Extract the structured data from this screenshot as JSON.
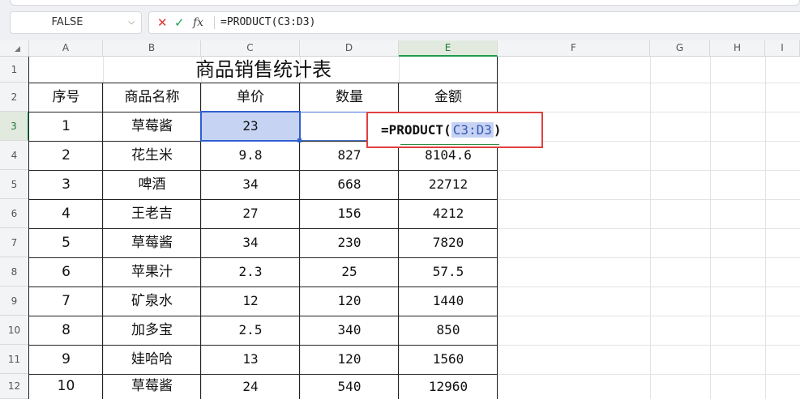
{
  "toolbar": {
    "name_box": "FALSE",
    "formula": "=PRODUCT(C3:D3)"
  },
  "columns": [
    "A",
    "B",
    "C",
    "D",
    "E",
    "F",
    "G",
    "H",
    "I"
  ],
  "rows": [
    "1",
    "2",
    "3",
    "4",
    "5",
    "6",
    "7",
    "8",
    "9",
    "10",
    "11",
    "12"
  ],
  "sheet": {
    "title": "商品销售统计表",
    "headers": [
      "序号",
      "商品名称",
      "单价",
      "数量",
      "金额"
    ],
    "data": [
      [
        "1",
        "草莓酱",
        "23",
        "",
        ""
      ],
      [
        "2",
        "花生米",
        "9.8",
        "827",
        "8104.6"
      ],
      [
        "3",
        "啤酒",
        "34",
        "668",
        "22712"
      ],
      [
        "4",
        "王老吉",
        "27",
        "156",
        "4212"
      ],
      [
        "5",
        "草莓酱",
        "34",
        "230",
        "7820"
      ],
      [
        "6",
        "苹果汁",
        "2.3",
        "25",
        "57.5"
      ],
      [
        "7",
        "矿泉水",
        "12",
        "120",
        "1440"
      ],
      [
        "8",
        "加多宝",
        "2.5",
        "340",
        "850"
      ],
      [
        "9",
        "娃哈哈",
        "13",
        "120",
        "1560"
      ],
      [
        "10",
        "草莓酱",
        "24",
        "540",
        "12960"
      ]
    ]
  },
  "editor": {
    "prefix": "=PRODUCT(",
    "ref": "C3:D3",
    "suffix": ")"
  },
  "colors": {
    "accent_green": "#1f9a4b",
    "selection_blue": "#2f5fd0",
    "edit_highlight_red": "#e0403f"
  }
}
